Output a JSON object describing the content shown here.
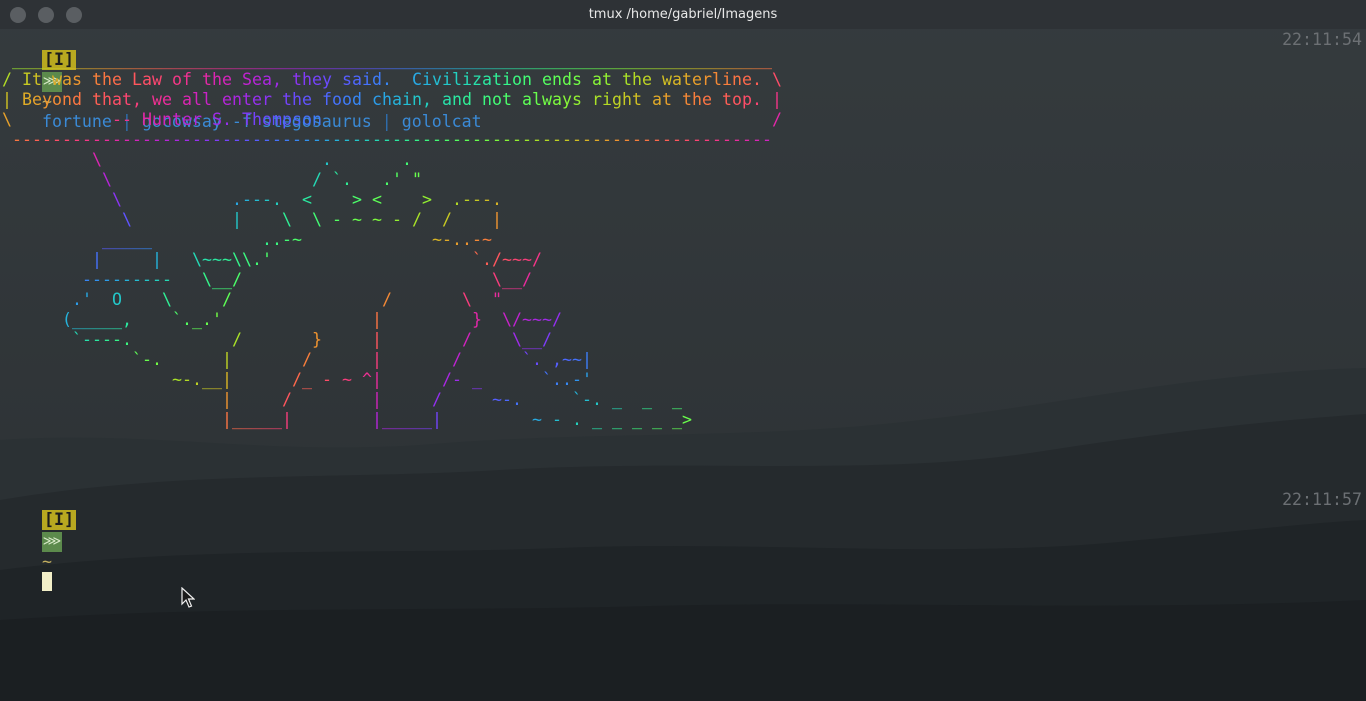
{
  "window": {
    "title": "tmux /home/gabriel/Imagens",
    "buttons": [
      "close",
      "minimize",
      "maximize"
    ]
  },
  "prompt1": {
    "indicator": "[I]",
    "glyph": "⋙",
    "tilde": "~",
    "timestamp": "22:11:54",
    "command_parts": [
      "fortune",
      "|",
      "gocowsay",
      "-f",
      "stegosaurus",
      "|",
      "gololcat"
    ]
  },
  "output_lines": [
    " ____________________________________________________________________________",
    "/ It was the Law of the Sea, they said.  Civilization ends at the waterline. \\",
    "| Beyond that, we all enter the food chain, and not always right at the top. |",
    "\\          -- Hunter S. Thompson                                             /",
    " ----------------------------------------------------------------------------",
    "         \\                      .       .",
    "          \\                    / `.   .' \"",
    "           \\           .---.  <    > <    >  .---.",
    "            \\          |    \\  \\ - ~ ~ - /  /    |",
    "          _____           ..-~             ~-..-~",
    "         |     |   \\~~~\\\\.'                    `./~~~/",
    "        ---------   \\__/                         \\__/",
    "       .'  O    \\     /               /       \\  \"",
    "      (_____,    `._.'               |         }  \\/~~~/",
    "       `----.          /       }     |        /    \\__/",
    "             `-.      |       /      |       /      `. ,~~|",
    "                 ~-.__|      /_ - ~ ^|      /- _      `..-'",
    "                      |     /        |     /     ~-.     `-. _  _  _",
    "                      |_____|        |_____|         ~ - . _ _ _ _ _>"
  ],
  "prompt2": {
    "indicator": "[I]",
    "glyph": "⋙",
    "tilde": "~",
    "timestamp": "22:11:57"
  },
  "colors": {
    "background": "#1f2326",
    "titlebar": "#2e3236",
    "indicator_bg": "#b8a820",
    "glyph_bg": "#5c8a4c",
    "timestamp": "#6c7074",
    "command": "#3a8ad6",
    "pipe": "#2e6fb0"
  }
}
